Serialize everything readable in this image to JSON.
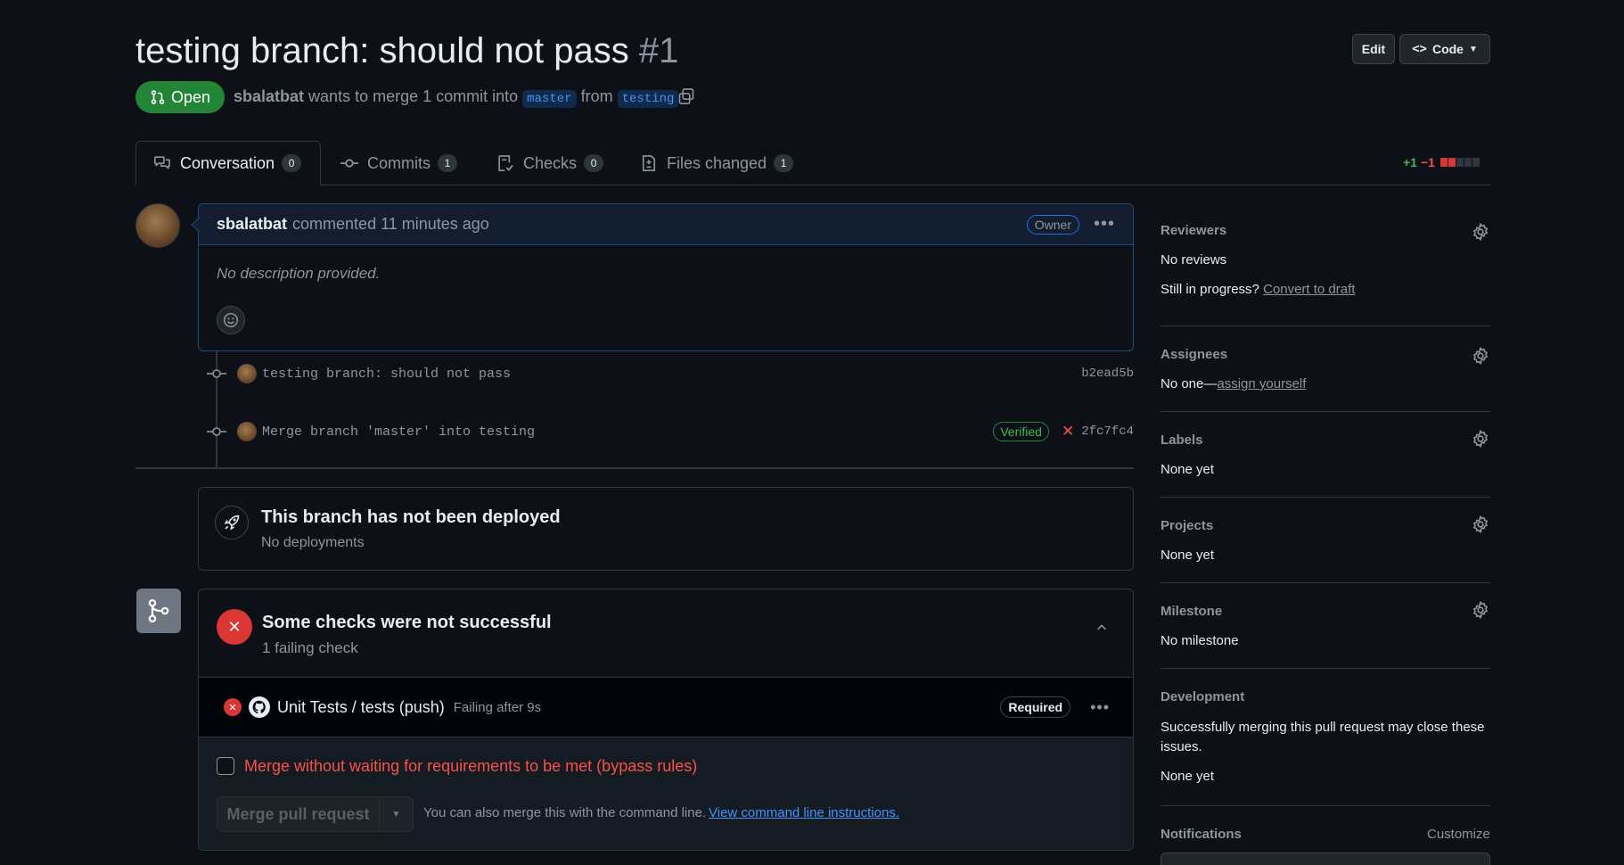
{
  "header": {
    "title": "testing branch: should not pass",
    "number": "#1",
    "edit_label": "Edit",
    "code_label": "Code",
    "state_label": "Open",
    "author": "sbalatbat",
    "merge_text": "wants to merge 1 commit into",
    "base_branch": "master",
    "from_text": "from",
    "head_branch": "testing"
  },
  "tabs": [
    {
      "label": "Conversation",
      "count": "0"
    },
    {
      "label": "Commits",
      "count": "1"
    },
    {
      "label": "Checks",
      "count": "0"
    },
    {
      "label": "Files changed",
      "count": "1"
    }
  ],
  "diffstat": {
    "added": "+1",
    "removed": "−1"
  },
  "comment": {
    "author": "sbalatbat",
    "meta": "commented 11 minutes ago",
    "role": "Owner",
    "body": "No description provided."
  },
  "commits": [
    {
      "message": "testing branch: should not pass",
      "sha": "b2ead5b",
      "verified": ""
    },
    {
      "message": "Merge branch 'master' into testing",
      "sha": "2fc7fc4",
      "verified": "Verified"
    }
  ],
  "deploy": {
    "title": "This branch has not been deployed",
    "subtitle": "No deployments"
  },
  "checks": {
    "title": "Some checks were not successful",
    "subtitle": "1 failing check",
    "check_name": "Unit Tests / tests (push)",
    "check_status": "Failing after 9s",
    "required_label": "Required",
    "bypass_label": "Merge without waiting for requirements to be met (bypass rules)",
    "merge_button": "Merge pull request",
    "cli_text": "You can also merge this with the command line.",
    "cli_link": "View command line instructions."
  },
  "sidebar": {
    "reviewers": {
      "heading": "Reviewers",
      "value": "No reviews",
      "draft_prefix": "Still in progress?",
      "draft_link": "Convert to draft"
    },
    "assignees": {
      "heading": "Assignees",
      "value": "No one—",
      "link": "assign yourself"
    },
    "labels": {
      "heading": "Labels",
      "value": "None yet"
    },
    "projects": {
      "heading": "Projects",
      "value": "None yet"
    },
    "milestone": {
      "heading": "Milestone",
      "value": "No milestone"
    },
    "development": {
      "heading": "Development",
      "desc": "Successfully merging this pull request may close these issues.",
      "value": "None yet"
    },
    "notifications": {
      "heading": "Notifications",
      "customize": "Customize"
    }
  },
  "colors": {
    "background": "#0d1117",
    "open_green": "#238636",
    "danger": "#f85149",
    "accent": "#4493f8"
  }
}
